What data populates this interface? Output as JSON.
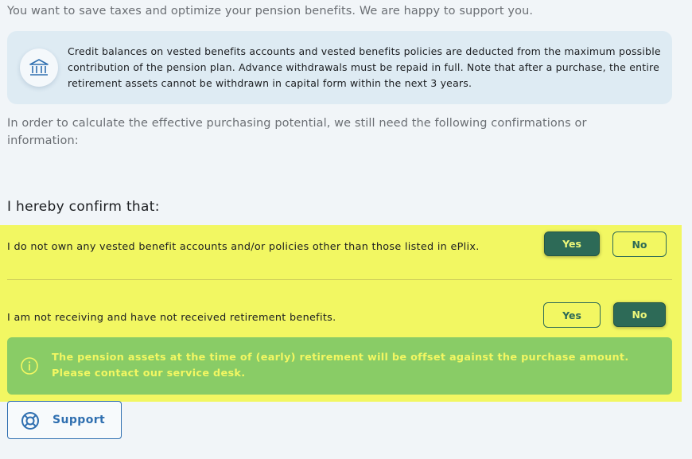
{
  "intro": "You want to save taxes and optimize your pension benefits. We are happy to support you.",
  "info_box": {
    "icon": "bank-icon",
    "text": "Credit balances on vested benefits accounts and vested benefits policies are deducted from the maximum possible contribution of the pension plan. Advance withdrawals must be repaid in full. Note that after a purchase, the entire retirement assets cannot be withdrawn in capital form within the next 3 years."
  },
  "calc_text": "In order to calculate the effective purchasing potential, we still need the following confirmations or information:",
  "confirm_heading": "I hereby confirm that:",
  "questions": [
    {
      "text": "I do not own any vested benefit accounts and/or policies other than those listed in ePlix.",
      "yes_label": "Yes",
      "no_label": "No",
      "selected": "Yes"
    },
    {
      "text": "I am not receiving and have not received retirement benefits.",
      "yes_label": "Yes",
      "no_label": "No",
      "selected": "No"
    }
  ],
  "notice": {
    "icon": "info-icon",
    "text": "The pension assets at the time of (early) retirement will be offset against the purchase amount. Please contact our service desk."
  },
  "support": {
    "icon": "lifebuoy-icon",
    "label": "Support"
  },
  "colors": {
    "highlight": "#f2f762",
    "accent_green": "#2d6a57",
    "notice_green": "#89cc66",
    "support_blue": "#2f6fb0"
  }
}
